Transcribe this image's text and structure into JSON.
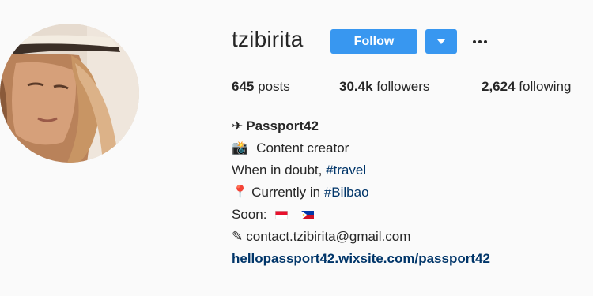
{
  "profile": {
    "username": "tzibirita",
    "follow_label": "Follow",
    "stats": {
      "posts": {
        "count": "645",
        "label": "posts"
      },
      "followers": {
        "count": "30.4k",
        "label": "followers"
      },
      "following": {
        "count": "2,624",
        "label": "following"
      }
    },
    "bio": {
      "name_icon": "✈",
      "name": "Passport42",
      "role_icon": "📸",
      "role": "Content creator",
      "doubt_prefix": "When in doubt, ",
      "doubt_tag": "#travel",
      "location_icon": "📍",
      "location_prefix": "Currently in ",
      "location_tag": "#Bilbao",
      "soon_label": "Soon:",
      "soon_flags": [
        "indonesia-flag",
        "philippines-flag"
      ],
      "email_icon": "✎",
      "email": "contact.tzibirita@gmail.com",
      "website": "hellopassport42.wixsite.com/passport42"
    }
  },
  "icons": {
    "dropdown": "chevron-down-icon",
    "more": "more-options-icon"
  },
  "colors": {
    "background": "#fafafa",
    "text": "#262626",
    "button": "#3897f0",
    "link": "#003569"
  }
}
